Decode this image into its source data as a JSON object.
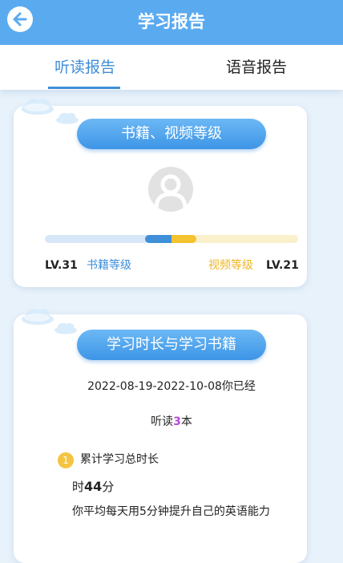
{
  "header": {
    "title": "学习报告",
    "back_icon": "back-arrow-icon"
  },
  "tabs": [
    {
      "label": "听读报告",
      "active": true
    },
    {
      "label": "语音报告",
      "active": false
    }
  ],
  "level_card": {
    "title": "书籍、视频等级",
    "book_level": "LV.31",
    "book_label": "书籍等级",
    "video_label": "视频等级",
    "video_level": "LV.21",
    "colors": {
      "book": "#3e8ed8",
      "video": "#f5c230"
    }
  },
  "study_card": {
    "title": "学习时长与学习书籍",
    "date_range_text": "2022-08-19-2022-10-08你已经",
    "listen_prefix": "听读",
    "listen_count": "3",
    "listen_suffix": "本",
    "item_number": "1",
    "item_title": "累计学习总时长",
    "duration_prefix": "时",
    "duration_minutes": "44",
    "duration_suffix": "分",
    "average_text": "你平均每天用5分钟提升自己的英语能力"
  }
}
